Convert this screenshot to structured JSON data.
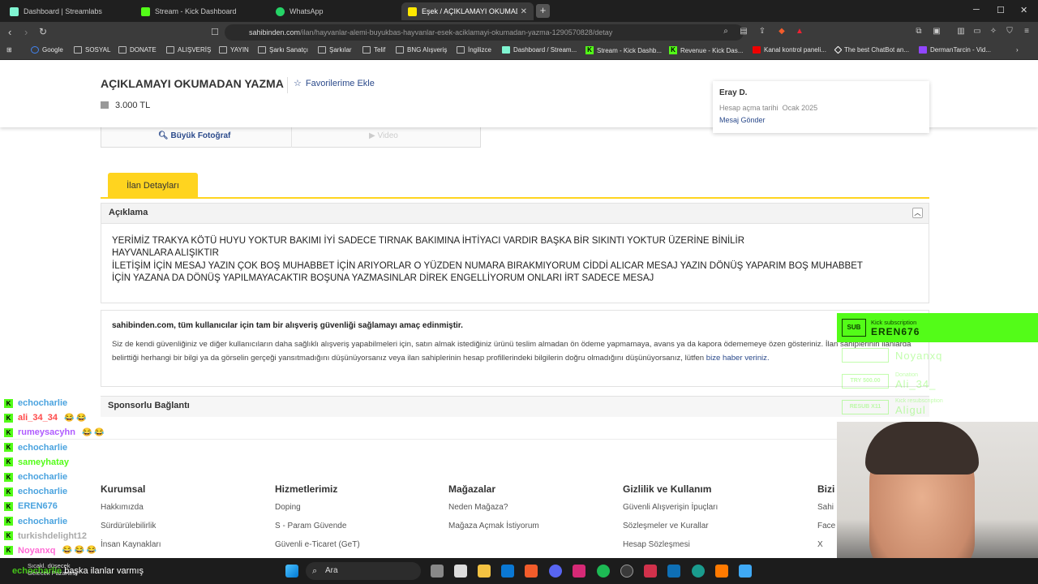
{
  "browser": {
    "tabs": [
      {
        "label": "Dashboard | Streamlabs",
        "color": "#80f5d2"
      },
      {
        "label": "Stream - Kick Dashboard",
        "color": "#53fc18"
      },
      {
        "label": "WhatsApp",
        "color": "#25d366"
      },
      {
        "label": "Eşek / AÇIKLAMAYI OKUMADAN",
        "color": "#ffe800"
      }
    ],
    "url_domain": "sahibinden.com",
    "url_path": "/ilan/hayvanlar-alemi-buyukbas-hayvanlar-esek-aciklamayi-okumadan-yazma-1290570828/detay",
    "bookmarks": [
      "Google",
      "SOSYAL",
      "DONATE",
      "ALIŞVERİŞ",
      "YAYIN",
      "Şarkı Sanatçı",
      "Şarkılar",
      "Telif",
      "BNG Alışveriş",
      "İngilizce",
      "Dashboard / Stream...",
      "Stream - Kick Dashb...",
      "Revenue - Kick Das...",
      "Kanal kontrol paneli...",
      "The best ChatBot an...",
      "DermanTarcin - Vid..."
    ]
  },
  "listing": {
    "title": "AÇIKLAMAYI OKUMADAN YAZMA",
    "favorite_label": "Favorilerime Ekle",
    "price": "3.000 TL",
    "big_photo": "Büyük Fotoğraf",
    "video": "Video",
    "details_tab": "İlan Detayları",
    "description_header": "Açıklama",
    "description_lines": [
      "YERİMİZ TRAKYA KÖTÜ HUYU YOKTUR BAKIMI İYİ SADECE TIRNAK BAKIMINA İHTİYACI VARDIR BAŞKA BİR SIKINTI YOKTUR ÜZERİNE BİNİLİR",
      "HAYVANLARA ALIŞIKTIR",
      "İLETİŞİM İÇİN MESAJ YAZIN ÇOK BOŞ MUHABBET İÇİN ARIYORLAR O YÜZDEN NUMARA BIRAKMIYORUM CİDDİ ALICAR MESAJ YAZIN DÖNÜŞ YAPARIM BOŞ MUHABBET",
      "İÇİN YAZANA DA DÖNÜŞ YAPILMAYACAKTIR BOŞUNA YAZMASINLAR DİREK ENGELLİYORUM ONLARI İRT SADECE MESAJ"
    ],
    "safety_title": "sahibinden.com, tüm kullanıcılar için tam bir alışveriş güvenliği sağlamayı amaç edinmiştir.",
    "safety_body": "Siz de kendi güvenliğiniz ve diğer kullanıcıların daha sağlıklı alışveriş yapabilmeleri için, satın almak istediğiniz ürünü teslim almadan ön ödeme yapmamaya, avans ya da kapora ödememeye özen gösteriniz. İlan sahiplerinin ilanlarda belirttiği herhangi bir bilgi ya da görselin gerçeği yansıtmadığını düşünüyorsanız veya ilan sahiplerinin hesap profillerindeki bilgilerin doğru olmadığını düşünüyorsanız, lütfen",
    "safety_link": "bize haber veriniz.",
    "sponsored": "Sponsorlu Bağlantı"
  },
  "seller": {
    "name": "Eray D.",
    "joined_label": "Hesap açma tarihi",
    "joined_date": "Ocak 2025",
    "message": "Mesaj Gönder"
  },
  "footer": {
    "columns": [
      {
        "title": "Kurumsal",
        "items": [
          "Hakkımızda",
          "Sürdürülebilirlik",
          "İnsan Kaynakları"
        ]
      },
      {
        "title": "Hizmetlerimiz",
        "items": [
          "Doping",
          "S - Param Güvende",
          "Güvenli e-Ticaret (GeT)"
        ]
      },
      {
        "title": "Mağazalar",
        "items": [
          "Neden Mağaza?",
          "Mağaza Açmak İstiyorum"
        ]
      },
      {
        "title": "Gizlilik ve Kullanım",
        "items": [
          "Güvenli Alışverişin İpuçları",
          "Sözleşmeler ve Kurallar",
          "Hesap Sözleşmesi"
        ]
      },
      {
        "title": "Bizi",
        "items": [
          "Sahi",
          "Face",
          "X"
        ]
      }
    ]
  },
  "chat": {
    "messages": [
      {
        "user": "echocharlie",
        "color": "#4aa3df",
        "text": ""
      },
      {
        "user": "ali_34_34",
        "color": "#ff4a4a",
        "text": "😂 😂"
      },
      {
        "user": "rumeysacyhn",
        "color": "#b05cff",
        "text": "😂 😂"
      },
      {
        "user": "echocharlie",
        "color": "#4aa3df",
        "text": ""
      },
      {
        "user": "sameyhatay",
        "color": "#53fc18",
        "text": ""
      },
      {
        "user": "echocharlie",
        "color": "#4aa3df",
        "text": ""
      },
      {
        "user": "echocharlie",
        "color": "#4aa3df",
        "text": ""
      },
      {
        "user": "EREN676",
        "color": "#4aa3df",
        "text": ""
      },
      {
        "user": "echocharlie",
        "color": "#4aa3df",
        "text": ""
      },
      {
        "user": "turkishdelight12",
        "color": "#aaaaaa",
        "text": ""
      },
      {
        "user": "Noyanxq",
        "color": "#ff6ad5",
        "text": "😂 😂 😂"
      }
    ],
    "input_user": "echocharlie",
    "input_text": "başka ilanlar varmış"
  },
  "alerts": {
    "sub_badge": "SUB",
    "sub_label": "Kick subscription",
    "sub_user": "EREN676",
    "events": [
      {
        "badge": "",
        "label": "",
        "user": "Noyanxq"
      },
      {
        "badge": "TRY 500.00",
        "label": "Donation",
        "user": "Ali_34_"
      },
      {
        "badge": "RESUB X11",
        "label": "Kick resubscription",
        "user": "Aligul"
      }
    ]
  },
  "taskbar": {
    "weather_line1": "Sıcakl. düşecek",
    "weather_line2": "Gelecek Pazartesi",
    "search_label": "Ara"
  }
}
